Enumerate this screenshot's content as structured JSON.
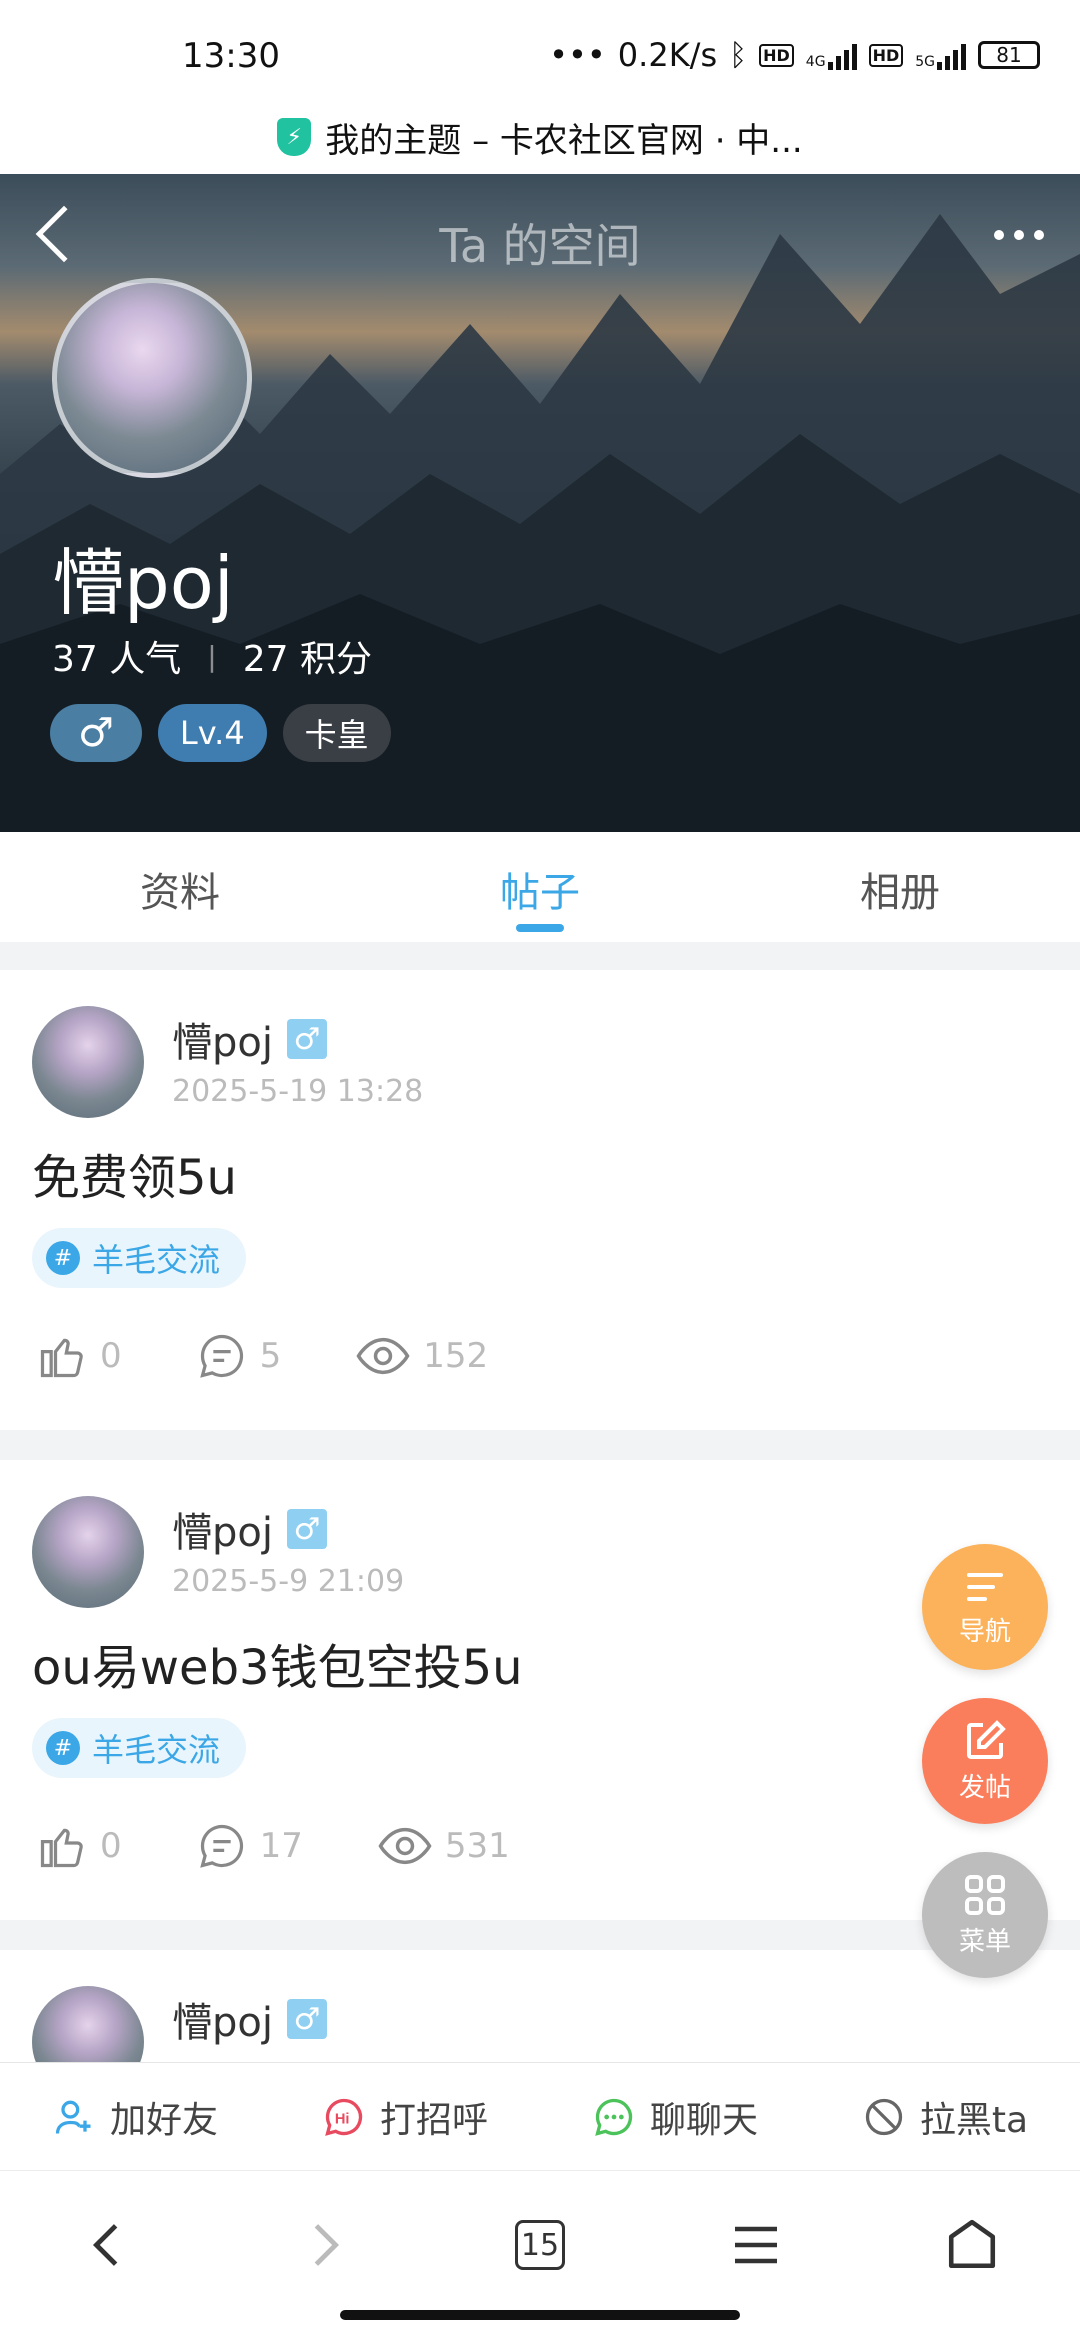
{
  "status_bar": {
    "time": "13:30",
    "network_speed": "0.2K/s",
    "hd_label": "HD",
    "net_4g": "4G",
    "net_5g": "5G",
    "battery": "81",
    "dots": "•••"
  },
  "address_bar": {
    "page_title": "我的主题 – 卡农社区官网 · 中..."
  },
  "header": {
    "title": "Ta 的空间"
  },
  "profile": {
    "name": "懵poj",
    "popularity_value": "37",
    "popularity_label": "人气",
    "points_value": "27",
    "points_label": "积分",
    "gender_symbol": "♂",
    "level": "Lv.4",
    "rank_title": "卡皇"
  },
  "tabs": [
    {
      "label": "资料"
    },
    {
      "label": "帖子"
    },
    {
      "label": "相册"
    }
  ],
  "posts": [
    {
      "author": "懵poj",
      "gender": "♂",
      "date": "2025-5-19 13:28",
      "title": "免费领5u",
      "tag": "羊毛交流",
      "likes": "0",
      "comments": "5",
      "views": "152"
    },
    {
      "author": "懵poj",
      "gender": "♂",
      "date": "2025-5-9 21:09",
      "title": "ou易web3钱包空投5u",
      "tag": "羊毛交流",
      "likes": "0",
      "comments": "17",
      "views": "531"
    },
    {
      "author": "懵poj",
      "gender": "♂"
    }
  ],
  "floating": {
    "nav_label": "导航",
    "post_label": "发帖",
    "menu_label": "菜单"
  },
  "action_bar": {
    "add_friend": "加好友",
    "say_hi": "打招呼",
    "chat": "聊聊天",
    "block": "拉黑ta"
  },
  "browser_nav": {
    "tab_count": "15"
  },
  "colors": {
    "accent": "#3ba7e6",
    "nav_fab": "#fbb25a",
    "post_fab": "#fa7e5c",
    "menu_fab": "#bdbdbd",
    "hi_icon": "#e84a5f",
    "chat_icon": "#4cc35a"
  }
}
